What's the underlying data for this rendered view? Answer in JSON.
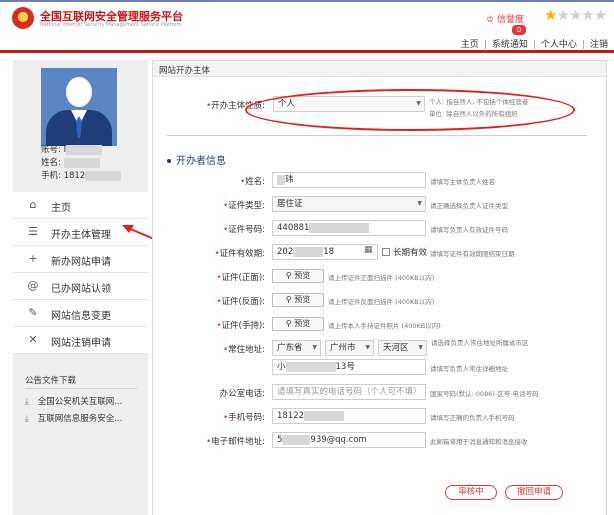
{
  "header": {
    "title": "全国互联网安全管理服务平台",
    "subtitle": "National Internet Security Management Service Platform",
    "credit_label": "信誉度",
    "notification_count": "0",
    "rating": 1,
    "rating_max": 5,
    "nav": [
      "主页",
      "系统通知",
      "个人中心",
      "注销"
    ],
    "colors": {
      "brand_red": "#c8161d",
      "accent_red": "#e4393c",
      "star": "#f5b400"
    }
  },
  "sidebar": {
    "account": {
      "id_label": "账号:",
      "id_value": "I",
      "name_label": "姓名:",
      "name_value": "",
      "phone_label": "手机:",
      "phone_value": "1812"
    },
    "menu": [
      {
        "icon": "home-icon",
        "glyph": "⌂",
        "label": "主页"
      },
      {
        "icon": "list-icon",
        "glyph": "☰",
        "label": "开办主体管理"
      },
      {
        "icon": "plus-icon",
        "glyph": "+",
        "label": "新办网站申请"
      },
      {
        "icon": "at-icon",
        "glyph": "@",
        "label": "已办网站认领"
      },
      {
        "icon": "edit-icon",
        "glyph": "✎",
        "label": "网站信息变更"
      },
      {
        "icon": "close-icon",
        "glyph": "✕",
        "label": "网站注销申请"
      }
    ],
    "public_docs_title": "公告文件下载",
    "public_docs": [
      "全国公安机关互联网...",
      "互联网信息服务安全..."
    ]
  },
  "panel": {
    "title": "网站开办主体",
    "entity_type": {
      "label": "开办主体性质:",
      "value": "个人",
      "hint_1": "个人: 指自然人, 不包括个体经营者",
      "hint_2": "单位: 除自然人以外的所有组织"
    },
    "section_title": "开办者信息",
    "fields": {
      "name": {
        "label": "姓名:",
        "value": "玮",
        "hint": "请填写主体负责人姓名"
      },
      "id_type": {
        "label": "证件类型:",
        "value": "居住证",
        "hint": "请正确选择负责人证件类型"
      },
      "id_number": {
        "label": "证件号码:",
        "value": "440881",
        "hint": "请填写负责人有效证件号码"
      },
      "id_validity": {
        "label": "证件有效期:",
        "value_start": "202",
        "value_end": "18",
        "long_term": "长期有效",
        "hint": "请填写证件有效期限结束日期"
      },
      "id_front": {
        "label": "证件(正面):",
        "button": "预览",
        "hint": "请上传证件正面扫描件 (400KB以内)"
      },
      "id_back": {
        "label": "证件(反面):",
        "button": "预览",
        "hint": "请上传证件反面扫描件 (400KB以内)"
      },
      "id_handheld": {
        "label": "证件(手持):",
        "button": "预览",
        "hint": "请上传本人手持证件照片 (400KB以内)"
      },
      "address": {
        "label": "常住地址:",
        "province": "广东省",
        "city": "广州市",
        "district": "天河区",
        "hint": "请选择负责人常住地址所属省市区"
      },
      "address_detail": {
        "value_start": "小",
        "value_end": "13号",
        "hint": "请填写负责人常住详细地址"
      },
      "office_phone": {
        "label": "办公室电话:",
        "placeholder": "请填写真实的电话号码（个人可不填）",
        "hint": "国家号码(默认: 0086)-区号-电话号码"
      },
      "mobile": {
        "label": "手机号码:",
        "value": "18122",
        "hint": "请填写正确的负责人手机号码"
      },
      "email": {
        "label": "电子邮件地址:",
        "value_start": "5",
        "value_end": "939@qq.com",
        "hint": "此邮箱将用于消息通知和消息接收"
      }
    },
    "actions": {
      "review": "审核中",
      "withdraw": "撤回申请"
    }
  }
}
